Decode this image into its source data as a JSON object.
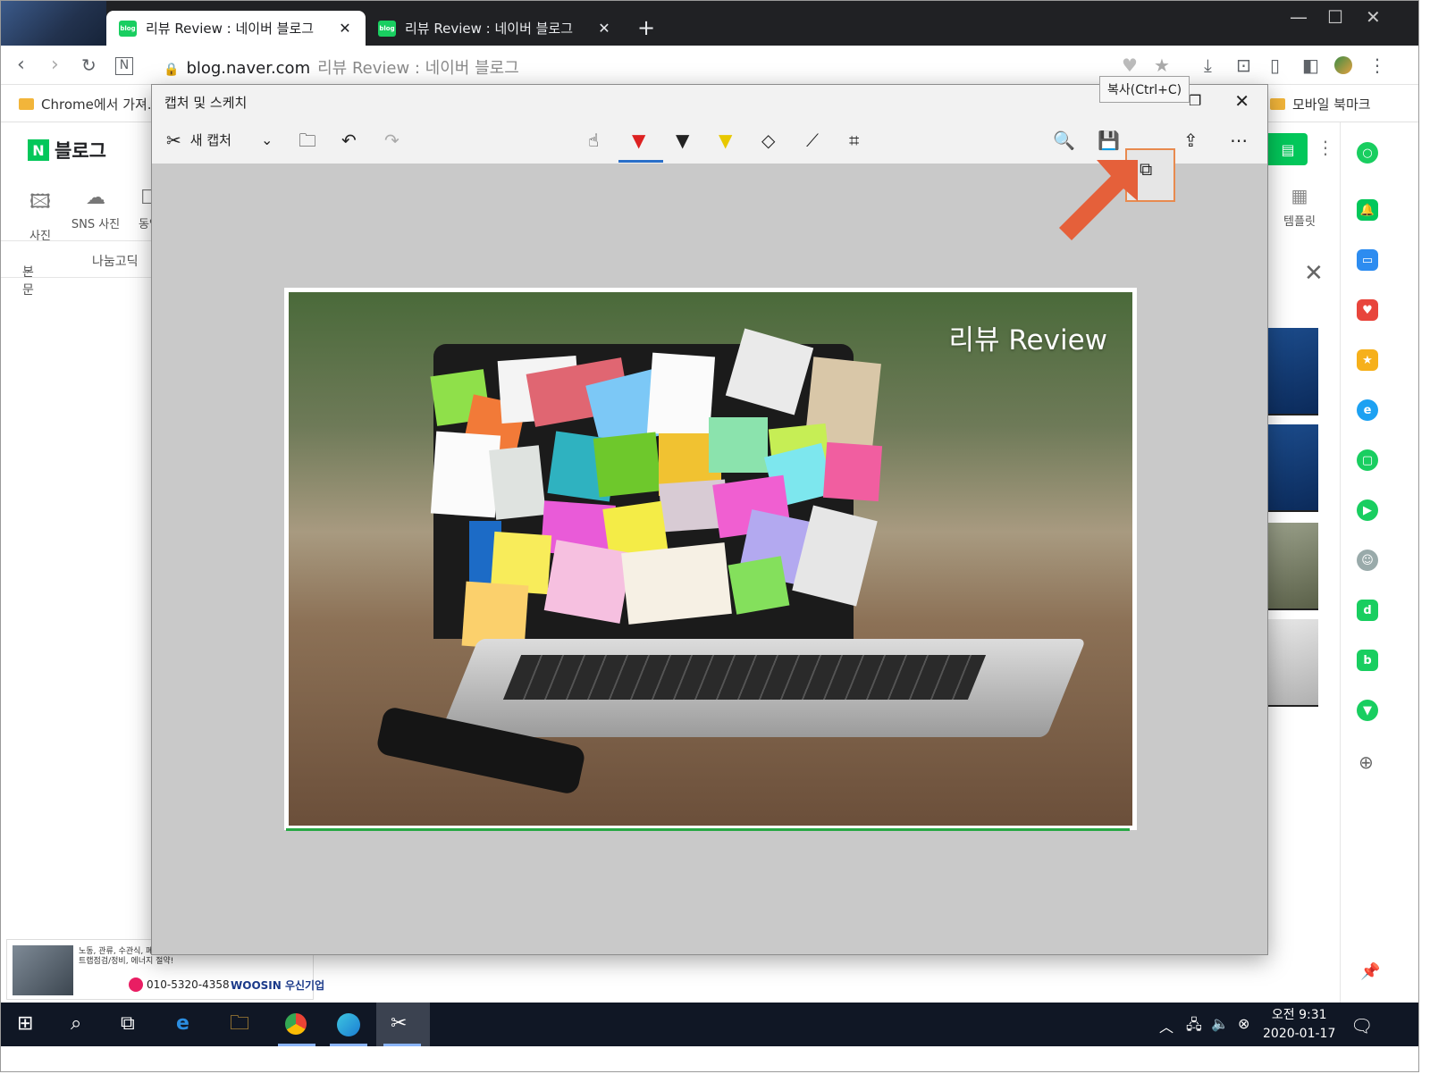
{
  "browser": {
    "tabs": [
      {
        "label": "리뷰 Review : 네이버 블로그",
        "favicon": "blog"
      },
      {
        "label": "리뷰 Review : 네이버 블로그",
        "favicon": "blog"
      }
    ],
    "new_tab": "+",
    "url_domain": "blog.naver.com",
    "url_page": "리뷰 Review : 네이버 블로그"
  },
  "bookmarks": {
    "left": "Chrome에서 가져...",
    "right": "모바일 북마크"
  },
  "blog": {
    "logo_n": "N",
    "logo_text": "블로그",
    "tools": [
      "사진",
      "SNS 사진",
      "동영"
    ],
    "paragraph_style": "본문",
    "font_name": "나눔고딕",
    "template_label": "템플릿"
  },
  "snip": {
    "title": "캡처 및 스케치",
    "new_capture": "새 캡처",
    "tooltip": "복사(Ctrl+C)",
    "image_title": "리뷰 Review"
  },
  "ad": {
    "description": "노동, 관류, 수관식, 폐열 보일러세관 및 연관교체, 각종설비공사 스팀트랩점검/정비, 에너지 절약!",
    "phone": "010-5320-4358",
    "brand": "WOOSIN 우신기업"
  },
  "taskbar": {
    "time": "오전 9:31",
    "date": "2020-01-17"
  },
  "colors": {
    "naver_green": "#03c75a",
    "highlight_orange": "#e88a4f",
    "arrow_orange": "#e5603a",
    "taskbar": "#101725"
  }
}
